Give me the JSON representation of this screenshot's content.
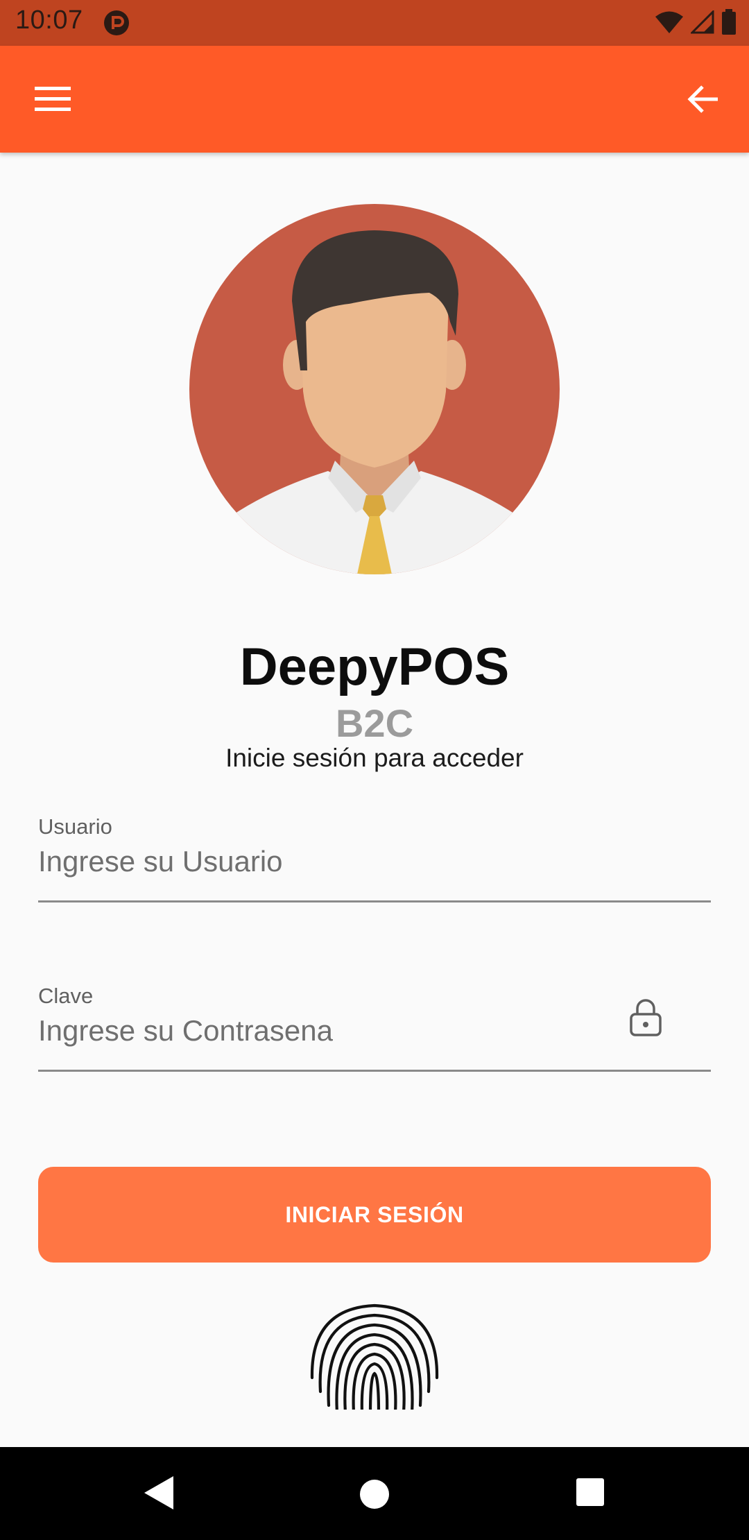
{
  "status_bar": {
    "time": "10:07",
    "icons": [
      "app-notification-icon",
      "wifi-icon",
      "signal-icon",
      "battery-icon"
    ]
  },
  "toolbar": {
    "menu_icon": "hamburger-menu-icon",
    "back_icon": "arrow-back-icon",
    "color": "#FF5A27"
  },
  "brand": {
    "title": "DeepyPOS",
    "subtitle": "B2C",
    "caption": "Inicie sesión para acceder"
  },
  "form": {
    "user": {
      "label": "Usuario",
      "placeholder": "Ingrese su Usuario",
      "value": ""
    },
    "password": {
      "label": "Clave",
      "placeholder": "Ingrese su Contrasena",
      "value": "",
      "icon": "lock-icon"
    },
    "submit_label": "INICIAR SESIÓN",
    "fingerprint_icon": "fingerprint-icon"
  },
  "colors": {
    "accent": "#FF5A27",
    "button": "#FF7644",
    "status_bar": "#BF4420",
    "avatar_bg": "#C65B45"
  },
  "nav_bar": {
    "icons": [
      "nav-back-icon",
      "nav-home-icon",
      "nav-recents-icon"
    ]
  }
}
